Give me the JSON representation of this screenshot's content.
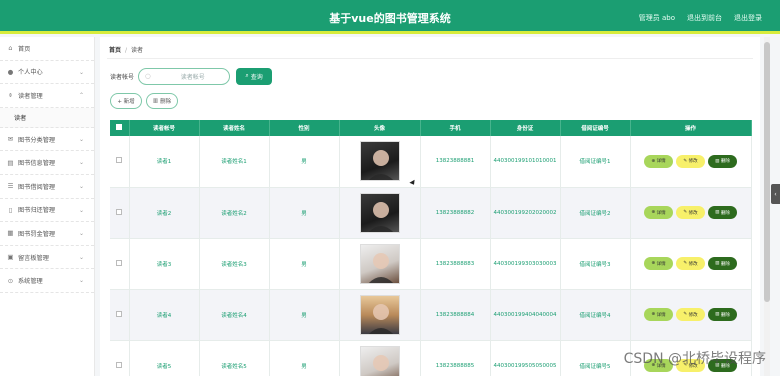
{
  "header": {
    "title": "基于vue的图书管理系统",
    "user_label": "管理员 abo",
    "frontend_link": "退出到前台",
    "logout_link": "退出登录"
  },
  "sidebar": {
    "items": [
      {
        "icon": "home-icon",
        "glyph": "⌂",
        "label": "首页",
        "chevron": false
      },
      {
        "icon": "user-icon",
        "glyph": "●",
        "label": "个人中心",
        "chevron": true
      },
      {
        "icon": "reader-icon",
        "glyph": "⌽",
        "label": "读者管理",
        "chevron": true,
        "expanded": true,
        "sub": [
          "读者"
        ]
      },
      {
        "icon": "mail-icon",
        "glyph": "✉",
        "label": "图书分类管理",
        "chevron": true
      },
      {
        "icon": "book-icon",
        "glyph": "▤",
        "label": "图书信息管理",
        "chevron": true
      },
      {
        "icon": "list-icon",
        "glyph": "☰",
        "label": "图书借阅管理",
        "chevron": true
      },
      {
        "icon": "phone-icon",
        "glyph": "▯",
        "label": "图书归还管理",
        "chevron": true
      },
      {
        "icon": "grid-icon",
        "glyph": "▦",
        "label": "图书罚金管理",
        "chevron": true
      },
      {
        "icon": "doc-icon",
        "glyph": "▣",
        "label": "留言板管理",
        "chevron": true
      },
      {
        "icon": "settings-icon",
        "glyph": "⊙",
        "label": "系统管理",
        "chevron": true
      }
    ]
  },
  "breadcrumb": {
    "home": "首页",
    "separator": "/",
    "current": "读者"
  },
  "search": {
    "label": "读者帐号",
    "placeholder": "读者帐号",
    "button": "查询"
  },
  "actions": {
    "add": "+ 新增",
    "delete": "删除"
  },
  "table": {
    "columns": [
      "读者帐号",
      "读者姓名",
      "性别",
      "头像",
      "手机",
      "身份证",
      "借阅证编号",
      "操作"
    ],
    "rows": [
      {
        "account": "读者1",
        "name": "读者姓名1",
        "gender": "男",
        "phone": "13823888881",
        "id_card": "440300199101010001",
        "card_no": "借阅证编号1",
        "photo": "dark"
      },
      {
        "account": "读者2",
        "name": "读者姓名2",
        "gender": "男",
        "phone": "13823888882",
        "id_card": "440300199202020002",
        "card_no": "借阅证编号2",
        "photo": "dark"
      },
      {
        "account": "读者3",
        "name": "读者姓名3",
        "gender": "男",
        "phone": "13823888883",
        "id_card": "440300199303030003",
        "card_no": "借阅证编号3",
        "photo": "light"
      },
      {
        "account": "读者4",
        "name": "读者姓名4",
        "gender": "男",
        "phone": "13823888884",
        "id_card": "440300199404040004",
        "card_no": "借阅证编号4",
        "photo": "outdoor"
      },
      {
        "account": "读者5",
        "name": "读者姓名5",
        "gender": "男",
        "phone": "13823888885",
        "id_card": "440300199505050005",
        "card_no": "借阅证编号5",
        "photo": "light"
      }
    ],
    "ops": {
      "detail": "详情",
      "edit": "修改",
      "delete": "删除"
    }
  },
  "watermark": "CSDN @北桥毕设程序",
  "colors": {
    "primary": "#1b9e72",
    "accent": "#d8ec3c",
    "detail": "#a8d65b",
    "edit": "#f7f06a",
    "delete": "#2d6b1e"
  }
}
